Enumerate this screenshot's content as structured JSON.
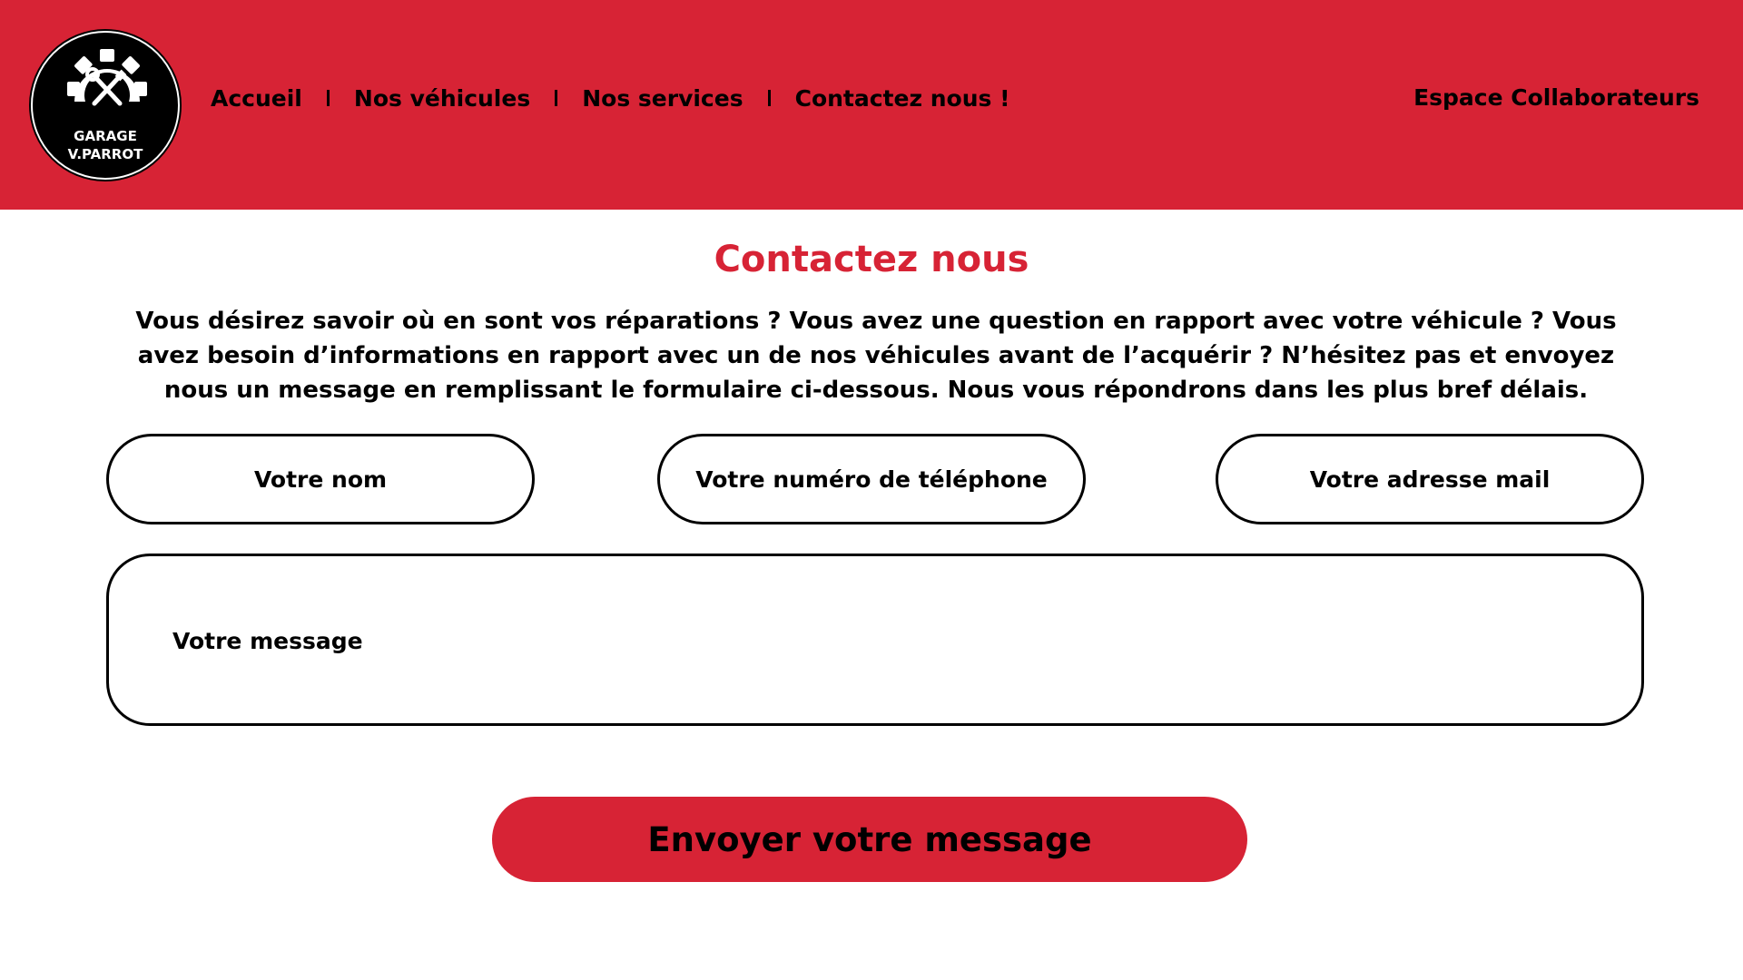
{
  "colors": {
    "brand_red": "#d72335",
    "text": "#000000",
    "background": "#ffffff"
  },
  "logo": {
    "icon": "gear-wrench-screwdriver-icon",
    "line1": "GARAGE",
    "line2": "V.PARROT"
  },
  "nav": {
    "items": [
      {
        "label": "Accueil"
      },
      {
        "label": "Nos véhicules"
      },
      {
        "label": "Nos services"
      },
      {
        "label": "Contactez nous !"
      }
    ],
    "separator": "I",
    "staff_link": "Espace Collaborateurs"
  },
  "main": {
    "title": "Contactez nous",
    "intro": "Vous désirez savoir où en sont vos réparations ? Vous avez une question en rapport avec votre véhicule ? Vous avez besoin d’informations en rapport avec un de nos véhicules avant de l’acquérir ? N’hésitez pas et envoyez nous un message en remplissant le formulaire ci-dessous. Nous vous répondrons dans les plus bref délais."
  },
  "form": {
    "name_placeholder": "Votre nom",
    "phone_placeholder": "Votre numéro de téléphone",
    "email_placeholder": "Votre adresse mail",
    "message_placeholder": "Votre message",
    "submit_label": "Envoyer votre message"
  }
}
